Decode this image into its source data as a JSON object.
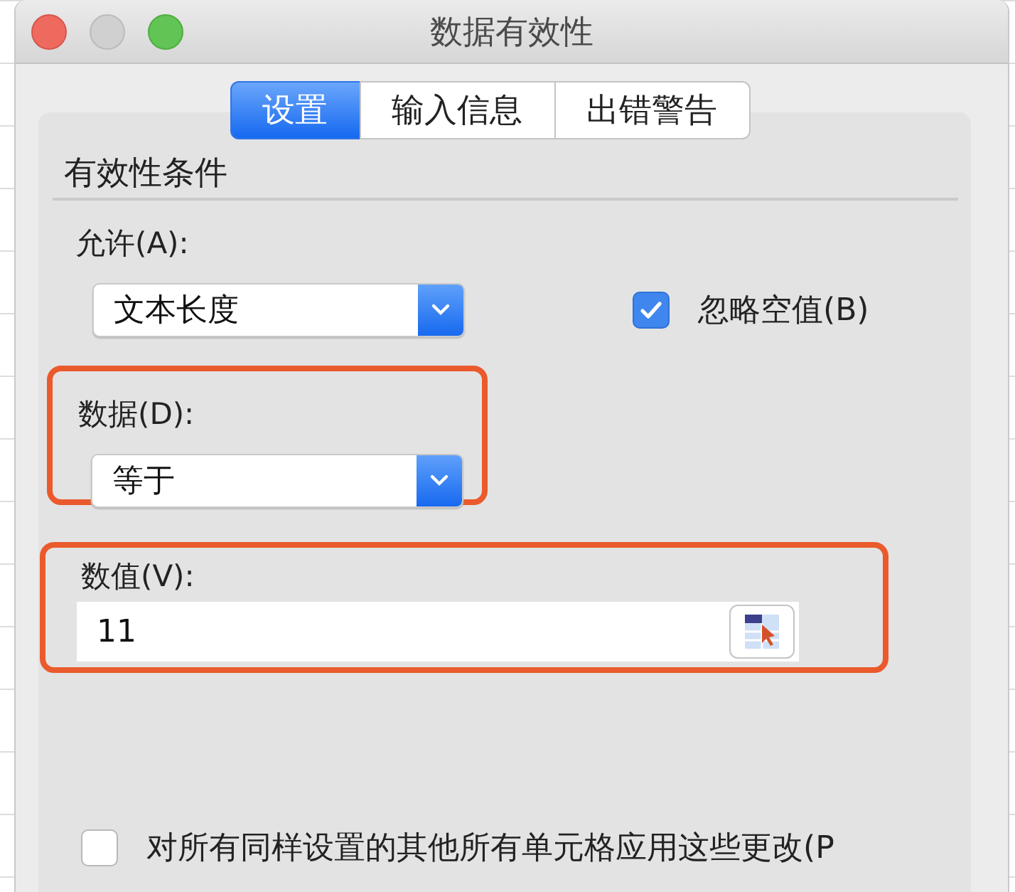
{
  "window": {
    "title": "数据有效性"
  },
  "tabs": [
    {
      "label": "设置",
      "selected": true
    },
    {
      "label": "输入信息",
      "selected": false
    },
    {
      "label": "出错警告",
      "selected": false
    }
  ],
  "section": {
    "title": "有效性条件"
  },
  "allow": {
    "label": "允许(A):",
    "value": "文本长度",
    "highlighted": false
  },
  "ignore_blank": {
    "label": "忽略空值(B)",
    "checked": true
  },
  "data": {
    "label": "数据(D):",
    "value": "等于",
    "highlighted": true
  },
  "value": {
    "label": "数值(V):",
    "value": "11",
    "highlighted": true
  },
  "apply_all": {
    "label": "对所有同样设置的其他所有单元格应用这些更改(P",
    "checked": false
  }
}
